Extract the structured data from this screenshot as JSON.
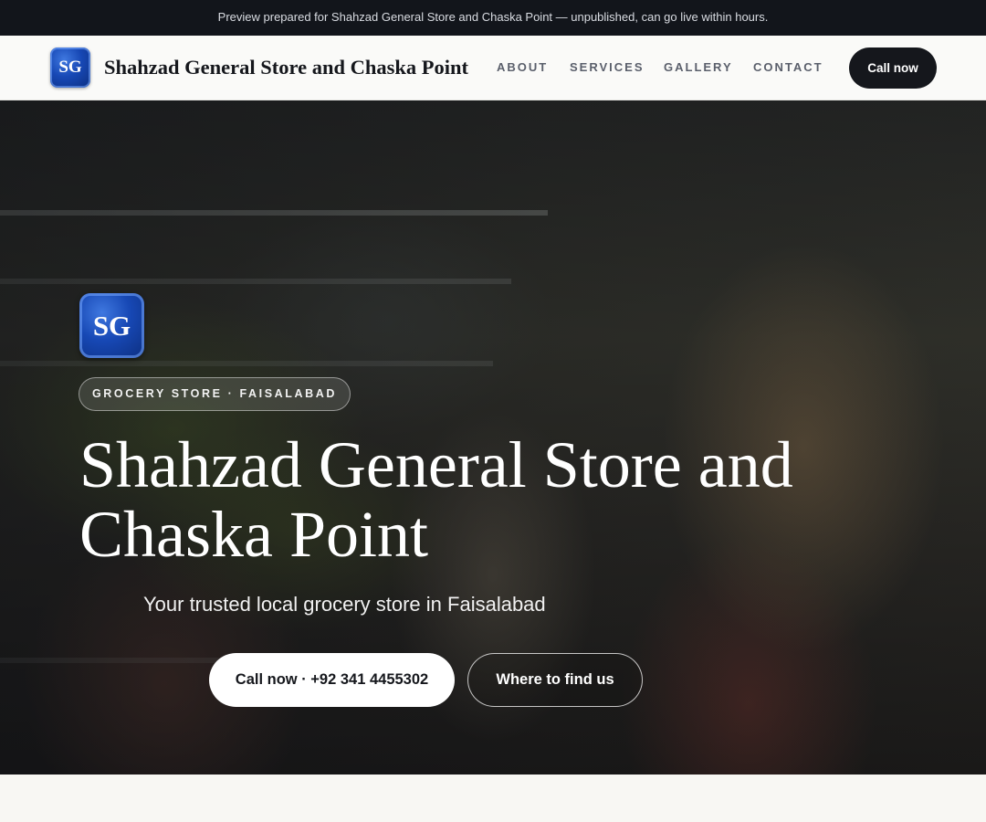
{
  "preview_banner": {
    "text": "Preview prepared for Shahzad General Store and Chaska Point — unpublished, can go live within hours."
  },
  "header": {
    "logo_text": "SG",
    "brand": "Shahzad General Store and Chaska Point",
    "nav": [
      {
        "label": "ABOUT"
      },
      {
        "label": "SERVICES"
      },
      {
        "label": "GALLERY"
      },
      {
        "label": "CONTACT"
      }
    ],
    "cta_label": "Call now"
  },
  "hero": {
    "logo_text": "SG",
    "badge": "GROCERY STORE · FAISALABAD",
    "title": "Shahzad General Store and Chaska Point",
    "subtitle": "Your trusted local grocery store in Faisalabad",
    "primary_button": "Call now · +92 341 4455302",
    "secondary_button": "Where to find us",
    "background_image": "woman reaching for products on grocery store shelf"
  },
  "colors": {
    "dark": "#15171c",
    "topbar": "#12151b",
    "logo_blue": "#1748b5",
    "page_background": "#f8f7f3"
  }
}
